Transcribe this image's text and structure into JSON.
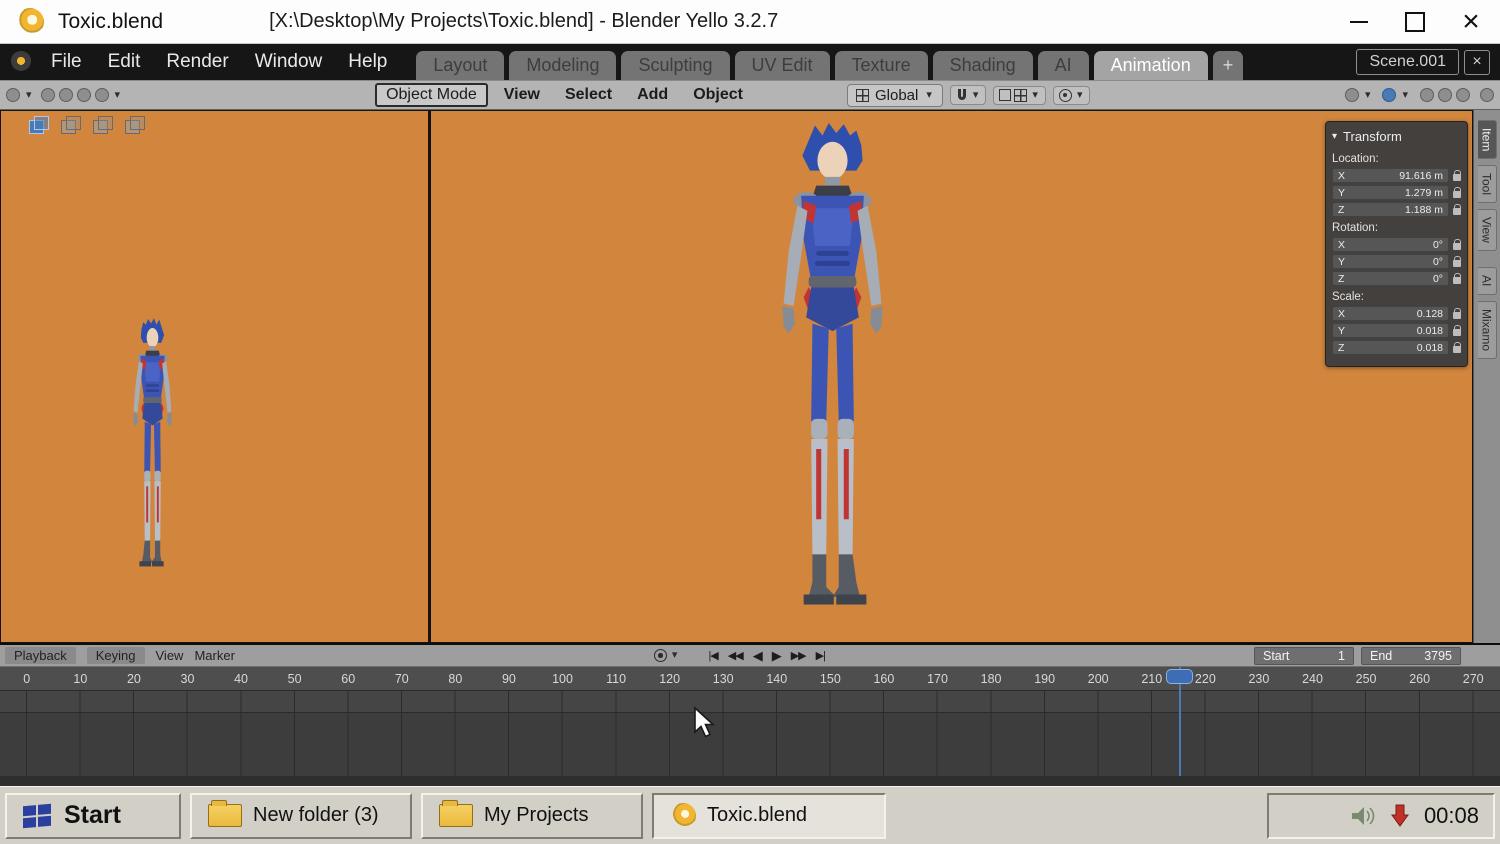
{
  "window": {
    "title": "Toxic.blend",
    "caption": "[X:\\Desktop\\My Projects\\Toxic.blend] - Blender Yello 3.2.7"
  },
  "icons": {
    "close": "×",
    "caret_down": "▾",
    "panel_collapse": "▾",
    "transport": {
      "jump_to_start": "|◀",
      "prev_keyframe": "◀◀",
      "play_reverse": "◀",
      "play": "▶",
      "next_keyframe": "▶▶",
      "jump_to_end": "▶|"
    }
  },
  "menubar": {
    "menus": [
      "File",
      "Edit",
      "Render",
      "Window",
      "Help"
    ],
    "tabs": [
      "Layout",
      "Modeling",
      "Sculpting",
      "UV Edit",
      "Texture",
      "Shading",
      "AI",
      "Animation"
    ],
    "active_tab": "Animation",
    "add_tab_label": "+",
    "scene_name": "Scene.001"
  },
  "toolbar": {
    "mode_label": "Object Mode",
    "menus": [
      "View",
      "Select",
      "Add",
      "Object"
    ],
    "orientation_label": "Global"
  },
  "transform_panel": {
    "title": "Transform",
    "location_label": "Location:",
    "location": [
      {
        "axis": "X",
        "value": "91.616 m"
      },
      {
        "axis": "Y",
        "value": "1.279 m"
      },
      {
        "axis": "Z",
        "value": "1.188 m"
      }
    ],
    "rotation_label": "Rotation:",
    "rotation": [
      {
        "axis": "X",
        "value": "0°"
      },
      {
        "axis": "Y",
        "value": "0°"
      },
      {
        "axis": "Z",
        "value": "0°"
      }
    ],
    "scale_label": "Scale:",
    "scale": [
      {
        "axis": "X",
        "value": "0.128"
      },
      {
        "axis": "Y",
        "value": "0.018"
      },
      {
        "axis": "Z",
        "value": "0.018"
      }
    ],
    "side_tabs": [
      "Item",
      "Tool",
      "View",
      "AI",
      "Mixamo"
    ]
  },
  "timeline": {
    "menus": [
      "Playback",
      "Keying",
      "View",
      "Marker"
    ],
    "start_label": "Start",
    "start_value": "1",
    "end_label": "End",
    "end_value": "3795",
    "current_frame": 217,
    "ticks": [
      0,
      10,
      20,
      30,
      40,
      50,
      60,
      70,
      80,
      90,
      100,
      110,
      120,
      130,
      140,
      150,
      160,
      170,
      180,
      190,
      200,
      210,
      220,
      230,
      240,
      250,
      260,
      270
    ]
  },
  "taskbar": {
    "start_label": "Start",
    "buttons": [
      {
        "label": "New folder (3)"
      },
      {
        "label": "My Projects"
      },
      {
        "label": "Toxic.blend"
      }
    ],
    "clock": "00:08"
  },
  "colors": {
    "viewport_background": "#d2853c",
    "accent_blue": "#3f6db5",
    "taskbar_gray": "#d2cfc7"
  }
}
